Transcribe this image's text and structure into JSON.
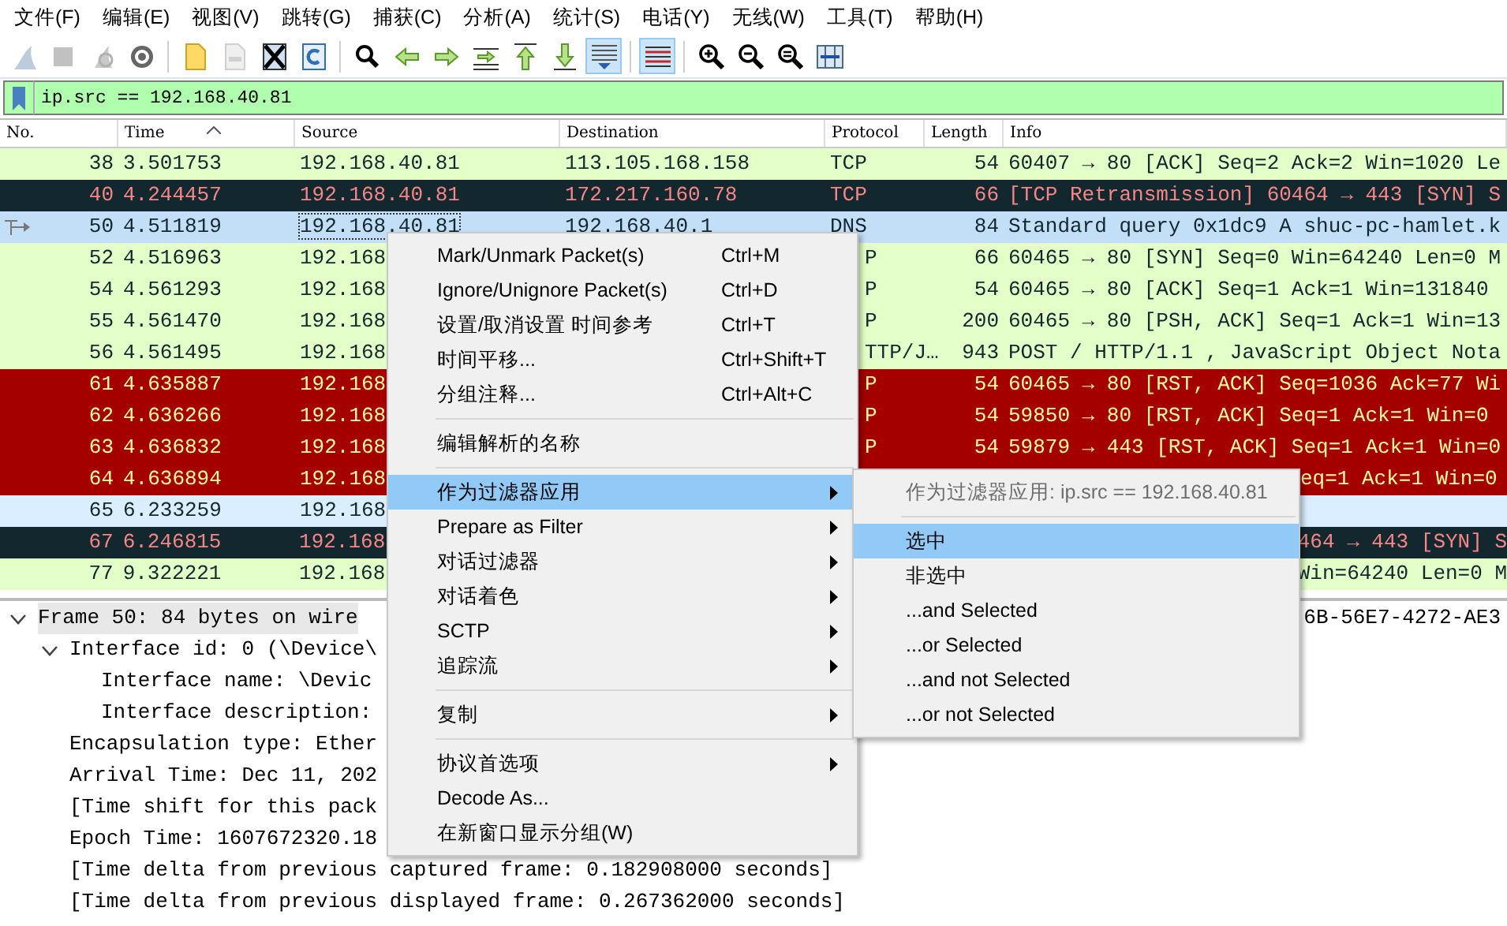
{
  "menu_bar": [
    "文件(F)",
    "编辑(E)",
    "视图(V)",
    "跳转(G)",
    "捕获(C)",
    "分析(A)",
    "统计(S)",
    "电话(Y)",
    "无线(W)",
    "工具(T)",
    "帮助(H)"
  ],
  "toolbar": [
    {
      "kind": "fin",
      "disabled": true,
      "pressed": false
    },
    {
      "kind": "stop",
      "disabled": true,
      "pressed": false
    },
    {
      "kind": "restart",
      "disabled": true,
      "pressed": false
    },
    {
      "kind": "gear",
      "disabled": false,
      "pressed": false
    },
    {
      "kind": "sep"
    },
    {
      "kind": "folder",
      "disabled": false,
      "pressed": false
    },
    {
      "kind": "file",
      "disabled": true,
      "pressed": false
    },
    {
      "kind": "closefile",
      "disabled": false,
      "pressed": false
    },
    {
      "kind": "reload",
      "disabled": false,
      "pressed": false
    },
    {
      "kind": "sep"
    },
    {
      "kind": "search",
      "disabled": false,
      "pressed": false
    },
    {
      "kind": "left",
      "disabled": false,
      "pressed": false
    },
    {
      "kind": "right",
      "disabled": false,
      "pressed": false
    },
    {
      "kind": "jump",
      "disabled": false,
      "pressed": false
    },
    {
      "kind": "top",
      "disabled": false,
      "pressed": false
    },
    {
      "kind": "bottom",
      "disabled": false,
      "pressed": false
    },
    {
      "kind": "autoscroll",
      "disabled": false,
      "pressed": true
    },
    {
      "kind": "sep"
    },
    {
      "kind": "colorize",
      "disabled": false,
      "pressed": true
    },
    {
      "kind": "sep"
    },
    {
      "kind": "zoomin",
      "disabled": false,
      "pressed": false
    },
    {
      "kind": "zoomout",
      "disabled": false,
      "pressed": false
    },
    {
      "kind": "zoomreset",
      "disabled": false,
      "pressed": false
    },
    {
      "kind": "resize",
      "disabled": false,
      "pressed": false
    }
  ],
  "display_filter": {
    "value": "ip.src == 192.168.40.81"
  },
  "packet_list": {
    "columns": [
      {
        "label": "No.",
        "sorted": false
      },
      {
        "label": "Time",
        "sorted": true
      },
      {
        "label": "Source",
        "sorted": false
      },
      {
        "label": "Destination",
        "sorted": false
      },
      {
        "label": "Protocol",
        "sorted": false
      },
      {
        "label": "Length",
        "sorted": false
      },
      {
        "label": "Info",
        "sorted": false
      }
    ],
    "rows": [
      {
        "kind": "full",
        "selected": false,
        "color": "#e4ffc7",
        "no": "38",
        "time": "3.501753",
        "source": "192.168.40.81",
        "destination": "113.105.168.158",
        "protocol": "TCP",
        "length": "54",
        "info": "60407 → 80 [ACK] Seq=2 Ack=2 Win=1020 Le"
      },
      {
        "kind": "full",
        "selected": false,
        "color": "#12272e",
        "no": "40",
        "time": "4.244457",
        "source": "192.168.40.81",
        "destination": "172.217.160.78",
        "protocol": "TCP",
        "length": "66",
        "info": "[TCP Retransmission] 60464 → 443 [SYN] S"
      },
      {
        "kind": "full",
        "selected": true,
        "color": "#c3dff7",
        "no": "50",
        "time": "4.511819",
        "source": "192.168.40.81",
        "destination": "192.168.40.1",
        "protocol": "DNS",
        "length": "84",
        "info": "Standard query 0x1dc9 A shuc-pc-hamlet.k"
      },
      {
        "kind": "under-menu",
        "selected": false,
        "color": "#e4ffc7",
        "no": "52",
        "time": "4.516963",
        "source": "192.168",
        "protocol": "P",
        "length": "66",
        "info": "60465 → 80 [SYN] Seq=0 Win=64240 Len=0 M"
      },
      {
        "kind": "under-menu",
        "selected": false,
        "color": "#e4ffc7",
        "no": "54",
        "time": "4.561293",
        "source": "192.168",
        "protocol": "P",
        "length": "54",
        "info": "60465 → 80 [ACK] Seq=1 Ack=1 Win=131840"
      },
      {
        "kind": "under-menu",
        "selected": false,
        "color": "#e4ffc7",
        "no": "55",
        "time": "4.561470",
        "source": "192.168",
        "protocol": "P",
        "length": "200",
        "info": "60465 → 80 [PSH, ACK] Seq=1 Ack=1 Win=13"
      },
      {
        "kind": "under-menu",
        "selected": false,
        "color": "#e4ffc7",
        "no": "56",
        "time": "4.561495",
        "source": "192.168",
        "protocol": "TTP/J…",
        "length": "943",
        "info": "POST / HTTP/1.1 , JavaScript Object Nota"
      },
      {
        "kind": "under-menu",
        "selected": false,
        "color": "#a40000",
        "no": "61",
        "time": "4.635887",
        "source": "192.168",
        "protocol": "P",
        "length": "54",
        "info": "60465 → 80 [RST, ACK] Seq=1036 Ack=77 Wi"
      },
      {
        "kind": "under-menu",
        "selected": false,
        "color": "#a40000",
        "no": "62",
        "time": "4.636266",
        "source": "192.168",
        "protocol": "P",
        "length": "54",
        "info": "59850 → 80 [RST, ACK] Seq=1 Ack=1 Win=0"
      },
      {
        "kind": "under-menu",
        "selected": false,
        "color": "#a40000",
        "no": "63",
        "time": "4.636832",
        "source": "192.168",
        "protocol": "P",
        "length": "54",
        "info": "59879 → 443 [RST, ACK] Seq=1 Ack=1 Win=0"
      },
      {
        "kind": "under-submenu",
        "selected": false,
        "color": "#a40000",
        "no": "64",
        "time": "4.636894",
        "source": "192.168",
        "info": "eq=1 Ack=1 Win=0"
      },
      {
        "kind": "under-submenu",
        "selected": false,
        "color": "#daeeff",
        "no": "65",
        "time": "6.233259",
        "source": "192.168"
      },
      {
        "kind": "under-submenu",
        "selected": false,
        "color": "#12272e",
        "no": "67",
        "time": "6.246815",
        "source": "192.168",
        "info": "464 → 443 [SYN] S"
      },
      {
        "kind": "under-submenu",
        "selected": false,
        "color": "#e4ffc7",
        "no": "77",
        "time": "9.322221",
        "source": "192.168",
        "info": "Win=64240 Len=0 M"
      }
    ]
  },
  "packet_details": [
    {
      "text": "Frame 50: 84 bytes on wire",
      "tail": "6B-56E7-4272-AE3",
      "selected": true,
      "expanded": true,
      "children": [
        {
          "text": "Interface id: 0 (\\Device\\",
          "selected": false,
          "expanded": true,
          "children": [
            {
              "text": "Interface name: \\Devic",
              "selected": false
            },
            {
              "text": "Interface description:",
              "selected": false
            }
          ]
        },
        {
          "text": "Encapsulation type: Ether",
          "selected": false
        },
        {
          "text": "Arrival Time: Dec 11, 202",
          "selected": false
        },
        {
          "text": "[Time shift for this pack",
          "selected": false
        },
        {
          "text": "Epoch Time: 1607672320.18",
          "selected": false
        },
        {
          "text": "[Time delta from previous captured frame: 0.182908000 seconds]",
          "selected": false
        },
        {
          "text": "[Time delta from previous displayed frame: 0.267362000 seconds]",
          "selected": false
        }
      ]
    }
  ],
  "context_menu": [
    {
      "kind": "item",
      "label": "Mark/Unmark Packet(s)",
      "shortcut": "Ctrl+M",
      "submenu": false,
      "selected": false
    },
    {
      "kind": "item",
      "label": "Ignore/Unignore Packet(s)",
      "shortcut": "Ctrl+D",
      "submenu": false,
      "selected": false
    },
    {
      "kind": "item",
      "label": "设置/取消设置 时间参考",
      "shortcut": "Ctrl+T",
      "submenu": false,
      "selected": false
    },
    {
      "kind": "item",
      "label": "时间平移...",
      "shortcut": "Ctrl+Shift+T",
      "submenu": false,
      "selected": false
    },
    {
      "kind": "item",
      "label": "分组注释...",
      "shortcut": "Ctrl+Alt+C",
      "submenu": false,
      "selected": false
    },
    {
      "kind": "separator"
    },
    {
      "kind": "item",
      "label": "编辑解析的名称",
      "submenu": false,
      "selected": false
    },
    {
      "kind": "separator"
    },
    {
      "kind": "item",
      "label": "作为过滤器应用",
      "submenu": true,
      "selected": true
    },
    {
      "kind": "item",
      "label": "Prepare as Filter",
      "submenu": true,
      "selected": false
    },
    {
      "kind": "item",
      "label": "对话过滤器",
      "submenu": true,
      "selected": false
    },
    {
      "kind": "item",
      "label": "对话着色",
      "submenu": true,
      "selected": false
    },
    {
      "kind": "item",
      "label": "SCTP",
      "submenu": true,
      "selected": false
    },
    {
      "kind": "item",
      "label": "追踪流",
      "submenu": true,
      "selected": false
    },
    {
      "kind": "separator"
    },
    {
      "kind": "item",
      "label": "复制",
      "submenu": true,
      "selected": false
    },
    {
      "kind": "separator"
    },
    {
      "kind": "item",
      "label": "协议首选项",
      "submenu": true,
      "selected": false
    },
    {
      "kind": "item",
      "label": "Decode As...",
      "submenu": false,
      "selected": false
    },
    {
      "kind": "item",
      "label": "在新窗口显示分组(W)",
      "submenu": false,
      "selected": false
    }
  ],
  "submenu": [
    {
      "kind": "header",
      "label": "作为过滤器应用: ip.src == 192.168.40.81",
      "disabled": true
    },
    {
      "kind": "separator"
    },
    {
      "kind": "item",
      "label": "选中",
      "selected": true
    },
    {
      "kind": "item",
      "label": "非选中",
      "selected": false
    },
    {
      "kind": "item",
      "label": "...and Selected",
      "selected": false
    },
    {
      "kind": "item",
      "label": "...or Selected",
      "selected": false
    },
    {
      "kind": "item",
      "label": "...and not Selected",
      "selected": false
    },
    {
      "kind": "item",
      "label": "...or not Selected",
      "selected": false
    }
  ]
}
